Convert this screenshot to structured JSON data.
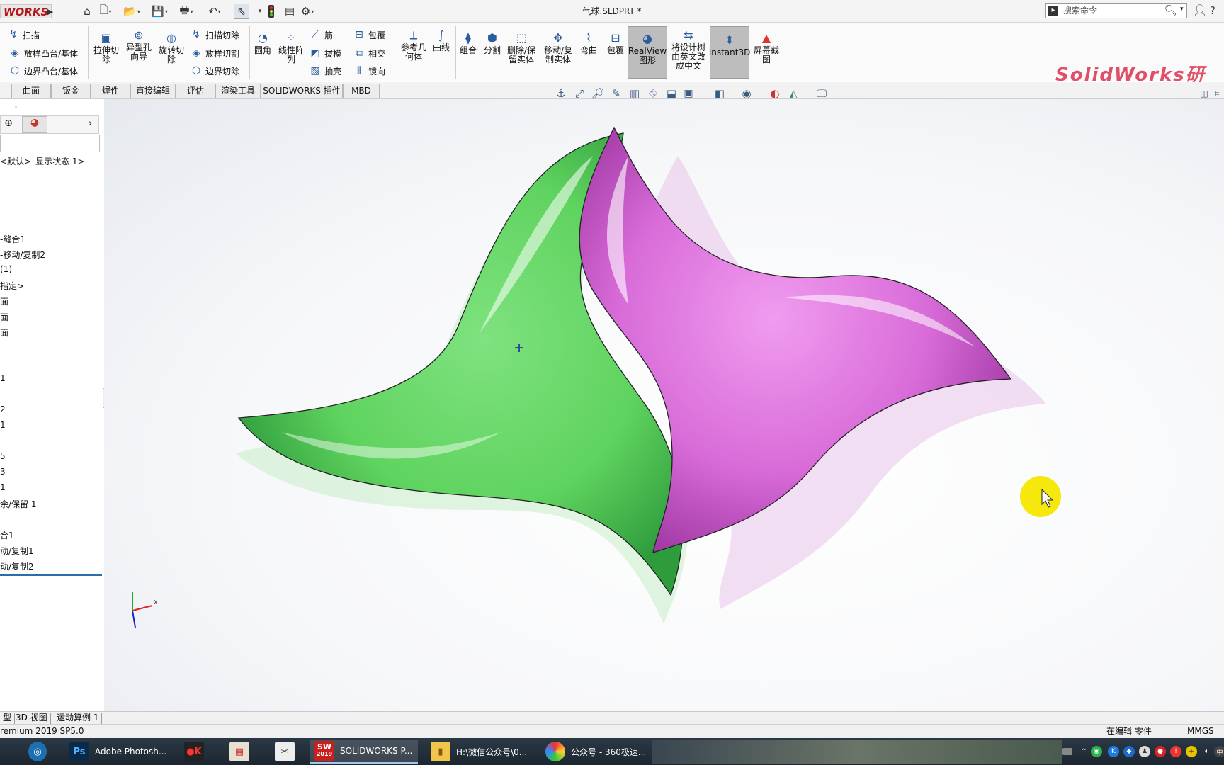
{
  "window": {
    "title": "气球.SLDPRT *",
    "app_logo": "WORKS"
  },
  "search": {
    "placeholder": "搜索命令"
  },
  "quick_access": [
    "home-icon",
    "new-file-icon",
    "open-icon",
    "save-icon",
    "print-icon",
    "undo-icon",
    "select-arrow-icon",
    "traffic-light-icon",
    "file-properties-icon",
    "options-gear-icon"
  ],
  "ribbon": {
    "sweep": "扫描",
    "loft_boss": "放样凸台/基体",
    "boundary_boss": "边界凸台/基体",
    "extruded_cut": "拉伸切除",
    "hole_wizard": "异型孔向导",
    "revolved_cut": "旋转切除",
    "swept_cut": "扫描切除",
    "lofted_cut": "放样切割",
    "boundary_cut": "边界切除",
    "fillet": "圆角",
    "linear_pattern": "线性阵列",
    "rib": "筋",
    "draft": "拔模",
    "shell": "抽壳",
    "wrap": "包覆",
    "intersect": "相交",
    "mirror": "镜向",
    "ref_geometry": "参考几何体",
    "curves": "曲线",
    "combine": "组合",
    "split": "分割",
    "delete_keep": "删除/保留实体",
    "move_copy": "移动/复制实体",
    "flex": "弯曲",
    "wrap2": "包覆",
    "realview": "RealView图形",
    "translate_tree": "将设计树由英文改成中文",
    "instant3d": "Instant3D",
    "screen_capture": "屏幕截图",
    "brand": "SolidWorks研"
  },
  "tabs": [
    "曲面",
    "钣金",
    "焊件",
    "直接编辑",
    "评估",
    "渲染工具",
    "SOLIDWORKS 插件",
    "MBD"
  ],
  "panel": {
    "display_state": "<默认>_显示状态 1>",
    "tree_items": [
      "-缝合1",
      "-移动/复制2",
      "(1)",
      "指定>",
      "面",
      "面",
      "面",
      "1",
      "2",
      "1",
      "5",
      "3",
      "1",
      "余/保留 1",
      "合1",
      "动/复制1",
      "动/复制2"
    ]
  },
  "bottom_tabs": [
    "型",
    "3D 视图",
    "运动算例 1"
  ],
  "status": {
    "version": "remium 2019 SP5.0",
    "editing": "在编辑 零件",
    "units": "MMGS"
  },
  "taskbar": {
    "items": [
      "Adobe Photosh...",
      "SOLIDWORKS P...",
      "H:\\微信公众号\\0...",
      "公众号 - 360极速..."
    ],
    "sw_badge": "2019"
  },
  "colors": {
    "green": "#5fd35f",
    "magenta": "#d86bd8",
    "cursor_highlight": "#f5e600",
    "brand": "#e04f68"
  }
}
